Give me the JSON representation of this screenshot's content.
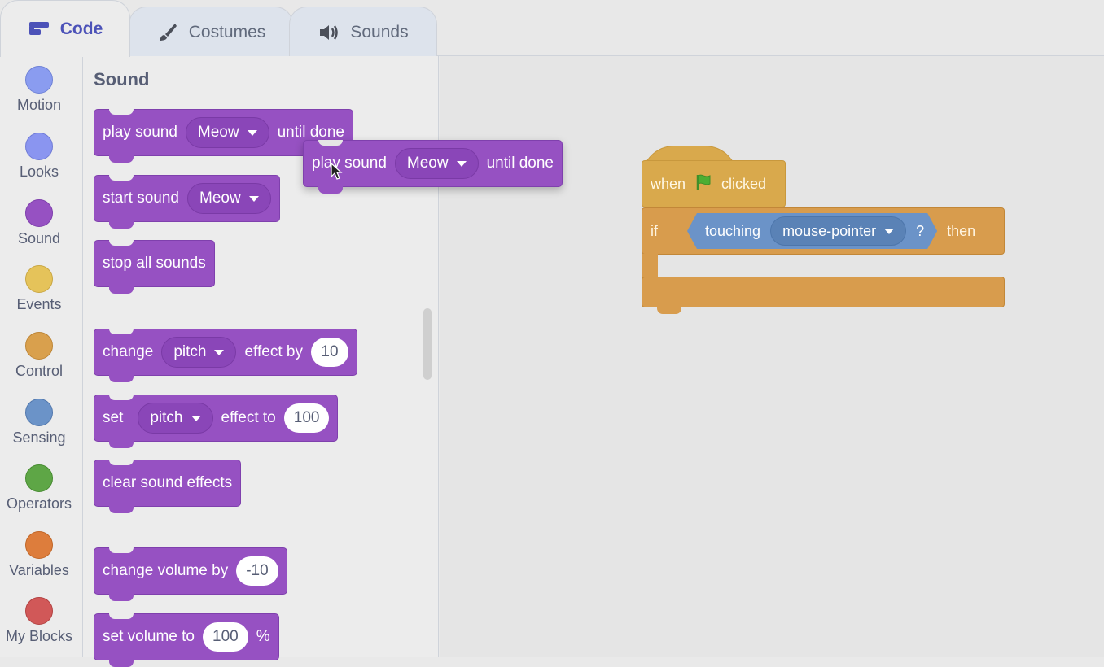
{
  "tabs": [
    {
      "label": "Code",
      "icon": "code-blocks-icon"
    },
    {
      "label": "Costumes",
      "icon": "paintbrush-icon"
    },
    {
      "label": "Sounds",
      "icon": "speaker-icon"
    }
  ],
  "categories": [
    {
      "label": "Motion",
      "color": "#8a9cf0"
    },
    {
      "label": "Looks",
      "color": "#8a95f0"
    },
    {
      "label": "Sound",
      "color": "#9651c2"
    },
    {
      "label": "Events",
      "color": "#e5c35a"
    },
    {
      "label": "Control",
      "color": "#d9a04d"
    },
    {
      "label": "Sensing",
      "color": "#6b93c8"
    },
    {
      "label": "Operators",
      "color": "#5ea646"
    },
    {
      "label": "Variables",
      "color": "#dd7d3c"
    },
    {
      "label": "My Blocks",
      "color": "#d15858"
    }
  ],
  "palette": {
    "title": "Sound",
    "blocks": {
      "play_until_done": {
        "prefix": "play sound",
        "sound": "Meow",
        "suffix": "until done"
      },
      "start_sound": {
        "prefix": "start sound",
        "sound": "Meow"
      },
      "stop_all": {
        "label": "stop all sounds"
      },
      "change_effect": {
        "prefix": "change",
        "effect": "pitch",
        "middle": "effect by",
        "value": "10"
      },
      "set_effect": {
        "prefix": "set",
        "effect": "pitch",
        "middle": "effect to",
        "value": "100"
      },
      "clear_effects": {
        "label": "clear sound effects"
      },
      "change_volume": {
        "prefix": "change volume by",
        "value": "-10"
      },
      "set_volume": {
        "prefix": "set volume to",
        "value": "100",
        "suffix": "%"
      }
    }
  },
  "dragging": {
    "prefix": "play sound",
    "sound": "Meow",
    "suffix": "until done"
  },
  "script": {
    "hat": {
      "prefix": "when",
      "suffix": "clicked"
    },
    "if": {
      "prefix": "if",
      "sensing_label": "touching",
      "target": "mouse-pointer",
      "question": "?",
      "then": "then"
    }
  }
}
